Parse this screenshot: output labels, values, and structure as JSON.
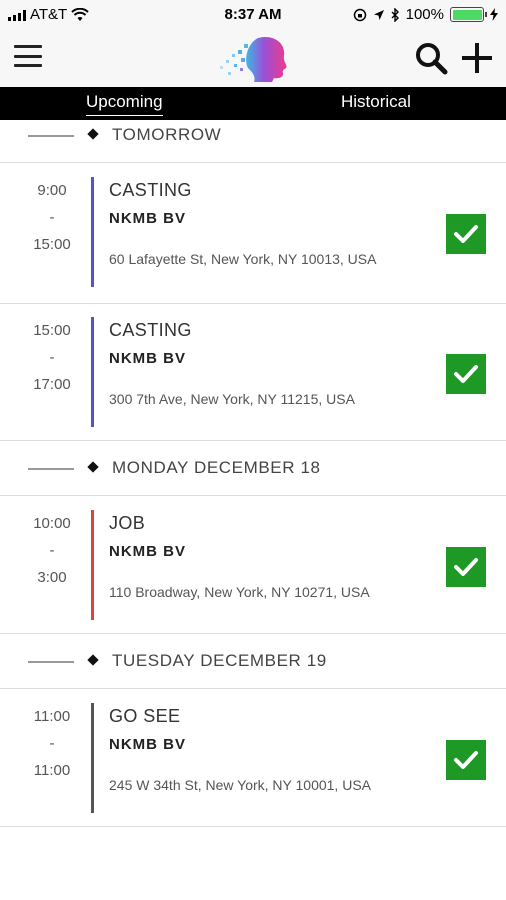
{
  "status_bar": {
    "carrier": "AT&T",
    "time": "8:37 AM",
    "battery_percent": "100%",
    "battery_level": 1.0
  },
  "header": {
    "icons": [
      "menu-icon",
      "app-logo",
      "search-icon",
      "plus-icon"
    ]
  },
  "tabs": [
    {
      "label": "Upcoming",
      "active": true
    },
    {
      "label": "Historical",
      "active": false
    }
  ],
  "days": [
    {
      "title": "TOMORROW",
      "events": [
        {
          "start": "9:00",
          "sep": "-",
          "end": "15:00",
          "type": "CASTING",
          "client": "NKMB BV",
          "address": "60 Lafayette St, New York, NY 10013, USA",
          "bar_color": "#5553c9",
          "confirmed": true
        },
        {
          "start": "15:00",
          "sep": "-",
          "end": "17:00",
          "type": "CASTING",
          "client": "NKMB BV",
          "address": "300 7th Ave, New York, NY 11215, USA",
          "bar_color": "#5553c9",
          "confirmed": true
        }
      ]
    },
    {
      "title": "MONDAY DECEMBER 18",
      "events": [
        {
          "start": "10:00",
          "sep": "-",
          "end": "3:00",
          "type": "JOB",
          "client": "NKMB BV",
          "address": "110 Broadway, New York, NY 10271, USA",
          "bar_color": "#d9443f",
          "confirmed": true
        }
      ]
    },
    {
      "title": "TUESDAY DECEMBER 19",
      "events": [
        {
          "start": "11:00",
          "sep": "-",
          "end": "11:00",
          "type": "GO SEE",
          "client": "NKMB BV",
          "address": "245 W 34th St, New York, NY 10001, USA",
          "bar_color": "#555555",
          "confirmed": true
        }
      ]
    }
  ],
  "colors": {
    "tab_bar": "#000000",
    "confirm_green": "#1e9926"
  }
}
